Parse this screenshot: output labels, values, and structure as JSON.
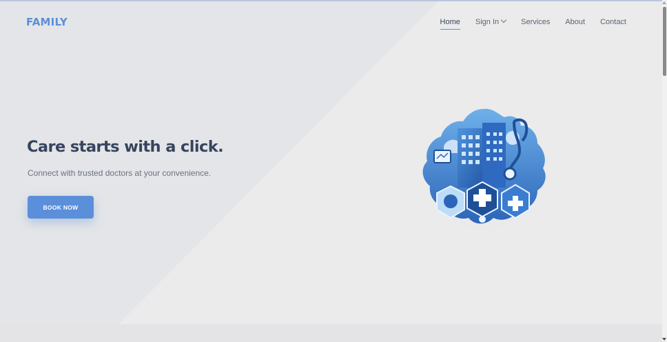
{
  "header": {
    "logo": "FAMILY",
    "nav": [
      {
        "label": "Home",
        "active": true
      },
      {
        "label": "Sign In",
        "has_dropdown": true
      },
      {
        "label": "Services"
      },
      {
        "label": "About"
      },
      {
        "label": "Contact"
      }
    ]
  },
  "hero": {
    "headline": "Care starts with a click.",
    "subtext": "Connect with trusted doctors at your convenience.",
    "cta_label": "BOOK NOW",
    "illustration": "hospital-medical-illustration"
  },
  "colors": {
    "accent": "#5b8fd9",
    "headline": "#37445d",
    "background": "#ebebec"
  }
}
